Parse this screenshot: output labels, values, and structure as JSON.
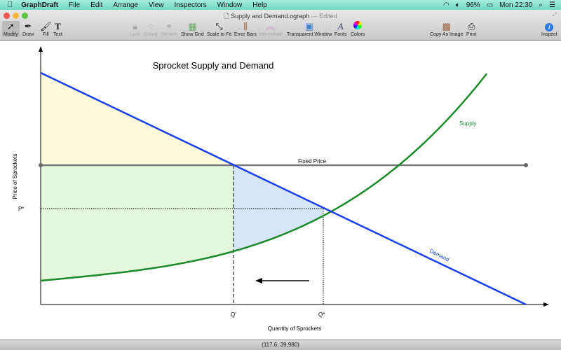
{
  "menubar": {
    "app": "GraphDraft",
    "items": [
      "File",
      "Edit",
      "Arrange",
      "View",
      "Inspectors",
      "Window",
      "Help"
    ],
    "battery": "96%",
    "clock": "Mon 22:30"
  },
  "window": {
    "title": "Supply and Demand.ograph",
    "edited": "— Edited"
  },
  "toolbar": {
    "modify": "Modify",
    "draw": "Draw",
    "fill": "Fill",
    "text": "Text",
    "lock": "Lock",
    "group": "Group",
    "detach": "Detach",
    "show_grid": "Show Grid",
    "scale_to_fit": "Scale to Fit",
    "error_bars": "Error Bars",
    "interpolate": "Interpolate",
    "transparent_window": "Transparent Window",
    "fonts": "Fonts",
    "colors": "Colors",
    "copy_as_image": "Copy As Image",
    "print": "Print",
    "inspect": "Inspect"
  },
  "graph": {
    "title": "Sprocket Supply and Demand",
    "xlabel": "Quantity of Sprockets",
    "ylabel": "Price of Sprockets",
    "supply_label": "Supply",
    "demand_label": "Demand",
    "fixed_price_label": "Fixed Price",
    "p_star": "P*",
    "q_prime": "Q'",
    "q_star": "Q*",
    "colors": {
      "supply": "#1a8a2a",
      "demand": "#1a3ff0",
      "fixed": "#777777",
      "consumer": "#fdfadc",
      "producer": "#e4f9dc",
      "deadweight": "#d6e6fa"
    }
  },
  "status": {
    "coords": "(117.6, 39,980)"
  }
}
